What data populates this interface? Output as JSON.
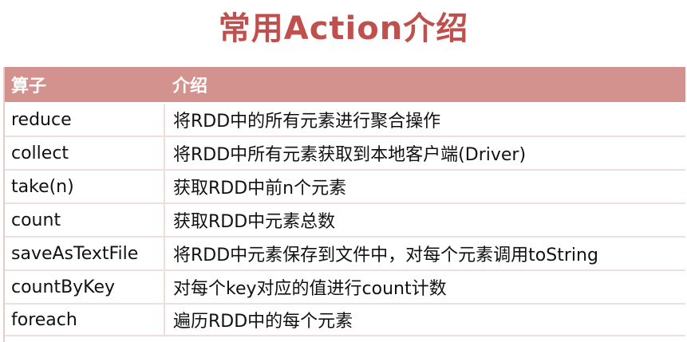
{
  "slide": {
    "title": "常用Action介绍"
  },
  "table": {
    "headers": [
      "算子",
      "介绍"
    ],
    "rows": [
      [
        "reduce",
        "将RDD中的所有元素进行聚合操作"
      ],
      [
        "collect",
        "将RDD中所有元素获取到本地客户端(Driver)"
      ],
      [
        "take(n)",
        "获取RDD中前n个元素"
      ],
      [
        "count",
        "获取RDD中元素总数"
      ],
      [
        "saveAsTextFile",
        "将RDD中元素保存到文件中，对每个元素调用toString"
      ],
      [
        "countByKey",
        "对每个key对应的值进行count计数"
      ],
      [
        "foreach",
        "遍历RDD中的每个元素"
      ]
    ]
  },
  "colors": {
    "title": "#c0504d",
    "header_bg": "#d4928f",
    "header_text": "#ffffff"
  }
}
